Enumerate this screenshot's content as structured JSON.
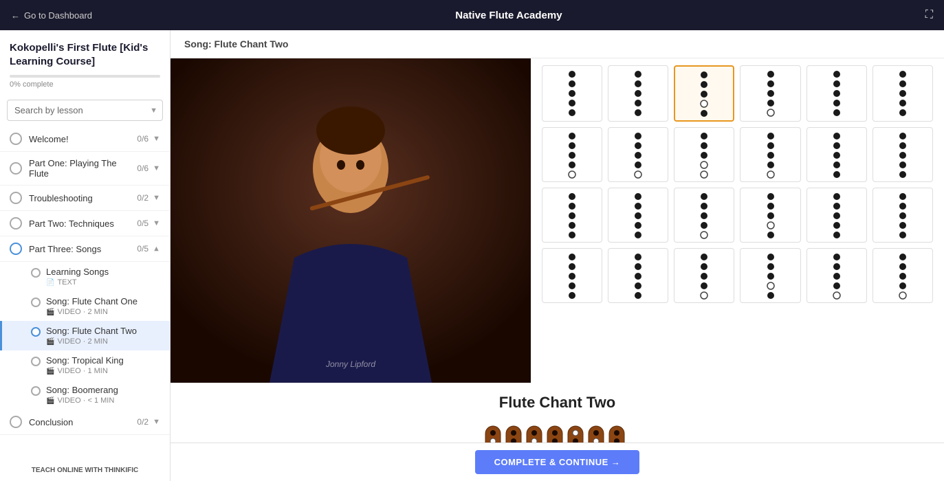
{
  "app": {
    "title": "Native Flute Academy",
    "back_label": "Go to Dashboard"
  },
  "course": {
    "title": "Kokopelli's First Flute [Kid's Learning Course]",
    "progress_percent": 0,
    "progress_label": "0% complete"
  },
  "search": {
    "placeholder": "Search by lesson"
  },
  "content": {
    "lesson_title": "Song: Flute Chant Two",
    "song_display_title": "Flute Chant Two",
    "video_credit": "Jonny Lipford",
    "complete_button": "COMPLETE & CONTINUE →"
  },
  "sidebar": {
    "sections": [
      {
        "id": "welcome",
        "label": "Welcome!",
        "progress": "0/6",
        "expanded": false
      },
      {
        "id": "part-one",
        "label": "Part One: Playing The Flute",
        "progress": "0/6",
        "expanded": false
      },
      {
        "id": "troubleshooting",
        "label": "Troubleshooting",
        "progress": "0/2",
        "expanded": false
      },
      {
        "id": "part-two",
        "label": "Part Two: Techniques",
        "progress": "0/5",
        "expanded": false
      },
      {
        "id": "part-three",
        "label": "Part Three: Songs",
        "progress": "0/5",
        "expanded": true
      },
      {
        "id": "conclusion",
        "label": "Conclusion",
        "progress": "0/2",
        "expanded": false
      }
    ],
    "part_three_lessons": [
      {
        "id": "learning-songs",
        "type": "text",
        "title": "Learning Songs",
        "meta": "TEXT"
      },
      {
        "id": "chant-one",
        "type": "video",
        "title": "Song: Flute Chant One",
        "meta": "VIDEO · 2 MIN"
      },
      {
        "id": "chant-two",
        "type": "video",
        "title": "Song: Flute Chant Two",
        "meta": "VIDEO · 2 MIN",
        "active": true
      },
      {
        "id": "tropical-king",
        "type": "video",
        "title": "Song: Tropical King",
        "meta": "VIDEO · 1 MIN"
      },
      {
        "id": "boomerang",
        "type": "video",
        "title": "Song: Boomerang",
        "meta": "VIDEO · < 1 MIN"
      }
    ],
    "powered_by": "TEACH ONLINE WITH",
    "brand": "THINKIFIC"
  }
}
